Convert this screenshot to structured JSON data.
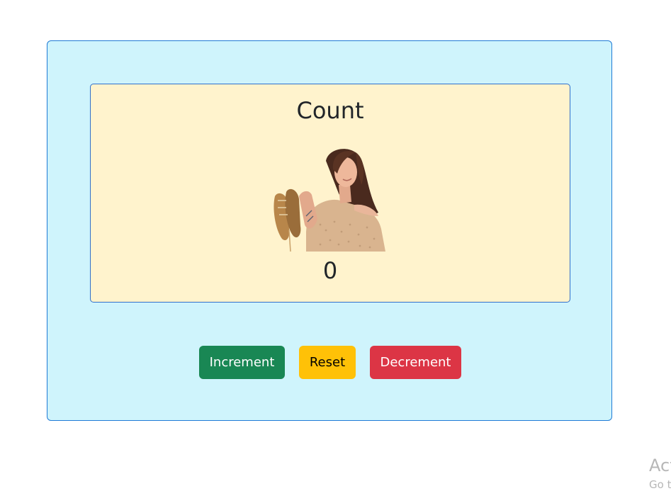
{
  "counter": {
    "title": "Count",
    "value": "0"
  },
  "buttons": {
    "increment_label": "Increment",
    "reset_label": "Reset",
    "decrement_label": "Decrement"
  },
  "colors": {
    "outer_card_bg": "#cff4fc",
    "inner_card_bg": "#fff3cd",
    "increment": "#198754",
    "reset": "#ffc107",
    "decrement": "#dc3545"
  },
  "image": {
    "alt": "woman-holding-shoes-image"
  },
  "watermark": {
    "line1": "Act",
    "line2": "Go t"
  }
}
